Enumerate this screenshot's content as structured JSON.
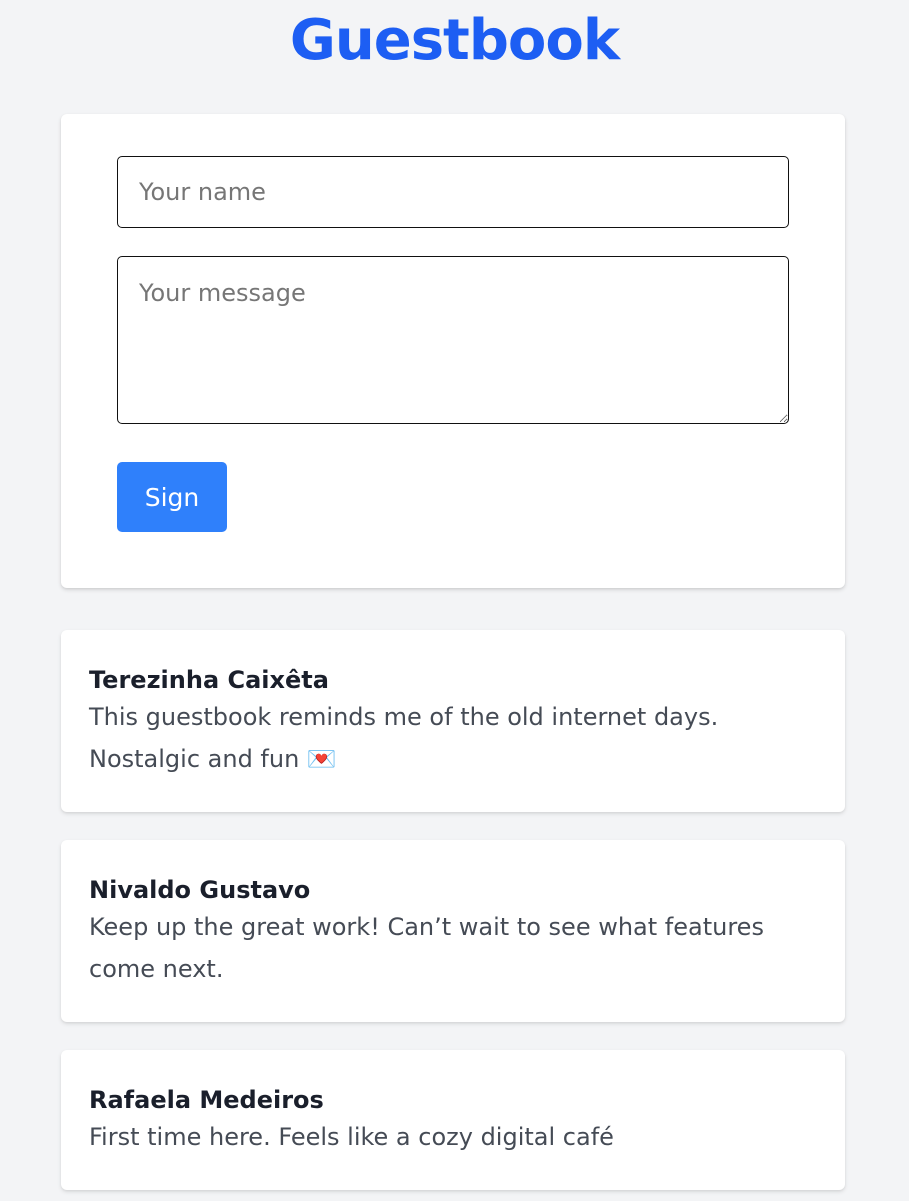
{
  "page": {
    "title": "Guestbook"
  },
  "form": {
    "name_placeholder": "Your name",
    "name_value": "",
    "message_placeholder": "Your message",
    "message_value": "",
    "sign_label": "Sign"
  },
  "entries": [
    {
      "name": "Terezinha Caixêta",
      "message": "This guestbook reminds me of the old internet days. Nostalgic and fun 💌"
    },
    {
      "name": "Nivaldo Gustavo",
      "message": "Keep up the great work! Can’t wait to see what features come next."
    },
    {
      "name": "Rafaela Medeiros",
      "message": "First time here. Feels like a cozy digital café"
    }
  ],
  "colors": {
    "accent": "#1d5ef3",
    "button": "#2f80fb",
    "background": "#f3f4f6",
    "card": "#ffffff",
    "entry_name": "#1a1f2b",
    "entry_text": "#454b55"
  }
}
